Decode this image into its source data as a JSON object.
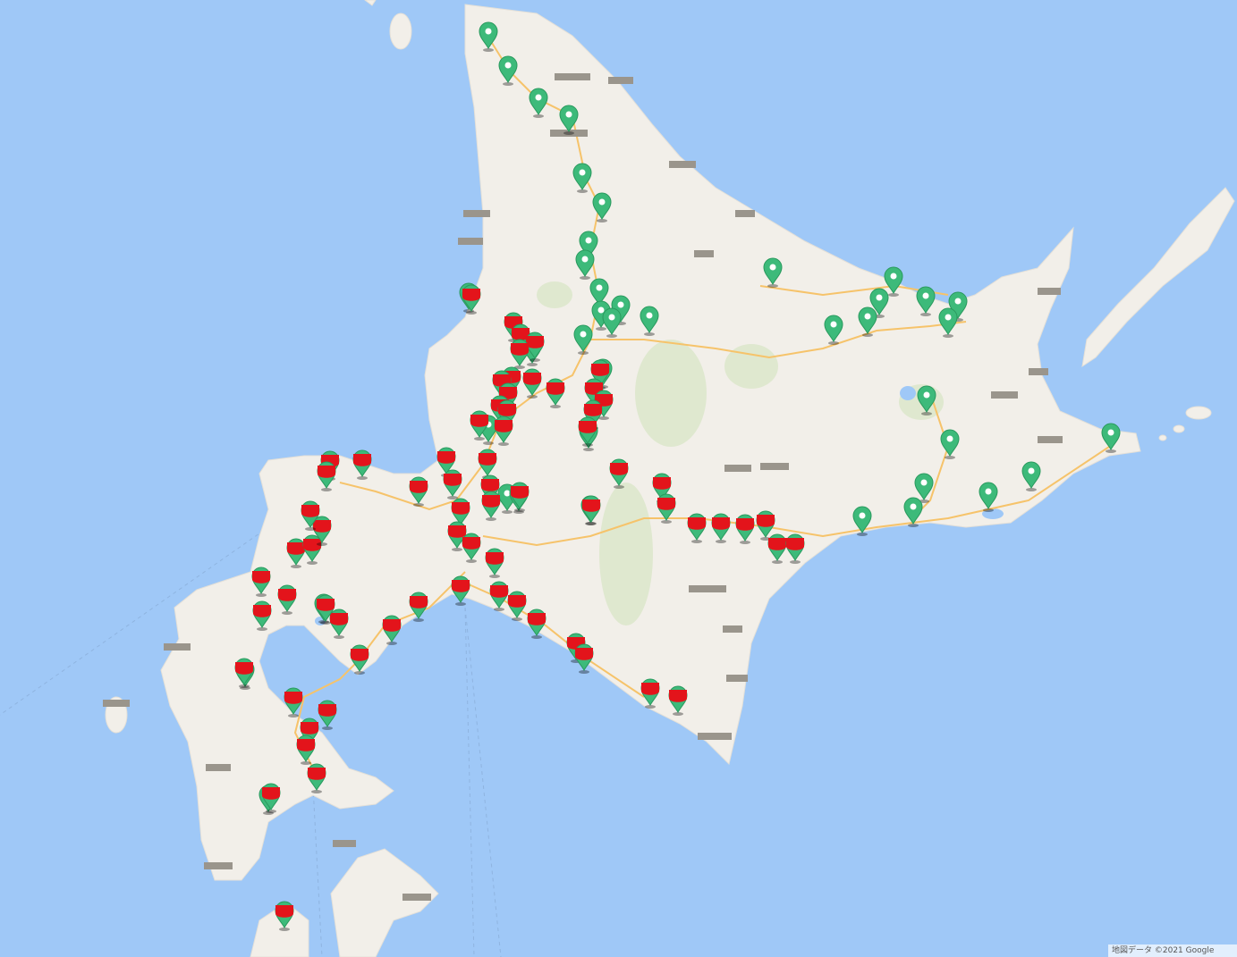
{
  "map": {
    "title": "",
    "attribution": "地図データ ©2021 Google"
  },
  "colors": {
    "water": "#9fc8f7",
    "land": "#f2efe9",
    "park": "#dfe8cf",
    "road": "#f6c36a",
    "marker_green": "#3dba7a",
    "marker_red": "#e3141b"
  },
  "icons": {
    "marker_green": "map-pin-icon",
    "marker_red": "map-pin-icon"
  },
  "markers": {
    "green_count": 41,
    "red_count": 71
  }
}
